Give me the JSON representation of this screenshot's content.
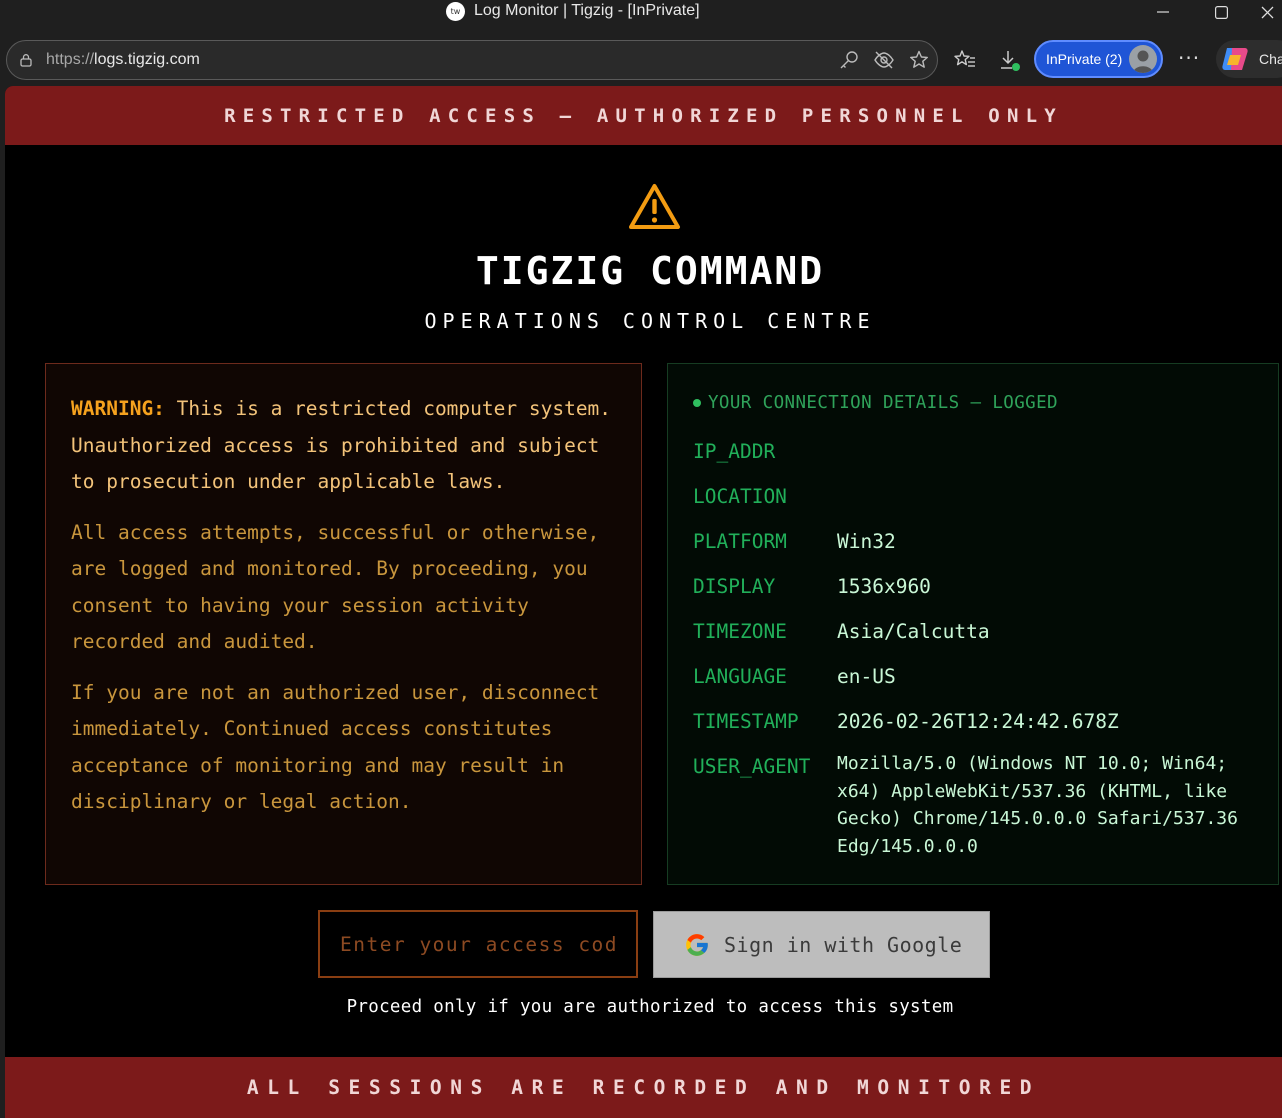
{
  "window": {
    "title": "Log Monitor | Tigzig - [InPrivate]",
    "favicon_text": "tw",
    "minimize_icon": "minimize-icon",
    "maximize_icon": "maximize-icon",
    "close_icon": "close-icon"
  },
  "addressbar": {
    "scheme": "https://",
    "host": "logs.tigzig.com"
  },
  "toolbar": {
    "inprivate_label": "InPrivate (2)",
    "more_label": "···",
    "copilot_label": "Cha"
  },
  "page": {
    "top_banner": "RESTRICTED ACCESS — AUTHORIZED PERSONNEL ONLY",
    "brand": "TIGZIG COMMAND",
    "subbrand": "OPERATIONS CONTROL CENTRE",
    "warning": {
      "keyword": "WARNING:",
      "lead": " This is a restricted computer system. Unauthorized access is prohibited and subject to prosecution under applicable laws.",
      "p2": "All access attempts, successful or otherwise, are logged and monitored. By proceeding, you consent to having your session activity recorded and audited.",
      "p3": "If you are not an authorized user, disconnect immediately. Continued access constitutes acceptance of monitoring and may result in disciplinary or legal action."
    },
    "connection": {
      "heading": "YOUR CONNECTION DETAILS — LOGGED",
      "rows": [
        {
          "key": "IP_ADDR",
          "value": ""
        },
        {
          "key": "LOCATION",
          "value": ""
        },
        {
          "key": "PLATFORM",
          "value": "Win32"
        },
        {
          "key": "DISPLAY",
          "value": "1536x960"
        },
        {
          "key": "TIMEZONE",
          "value": "Asia/Calcutta"
        },
        {
          "key": "LANGUAGE",
          "value": "en-US"
        },
        {
          "key": "TIMESTAMP",
          "value": "2026-02-26T12:24:42.678Z"
        }
      ],
      "user_agent_key": "USER_AGENT",
      "user_agent": "Mozilla/5.0 (Windows NT 10.0; Win64; x64) AppleWebKit/537.36 (KHTML, like Gecko) Chrome/145.0.0.0 Safari/537.36 Edg/145.0.0.0"
    },
    "access_input": {
      "placeholder": "Enter your access code",
      "value": ""
    },
    "google_button_label": "Sign in with Google",
    "proceed_text": "Proceed only if you are authorized to access this system",
    "bottom_banner": "ALL SESSIONS ARE RECORDED AND MONITORED"
  },
  "colors": {
    "banner": "#7c1a1a",
    "warning_accent": "#f6a21e",
    "terminal_green": "#21b05a",
    "input_border": "#8a3e12",
    "google_button_bg": "#bdbdbd"
  }
}
